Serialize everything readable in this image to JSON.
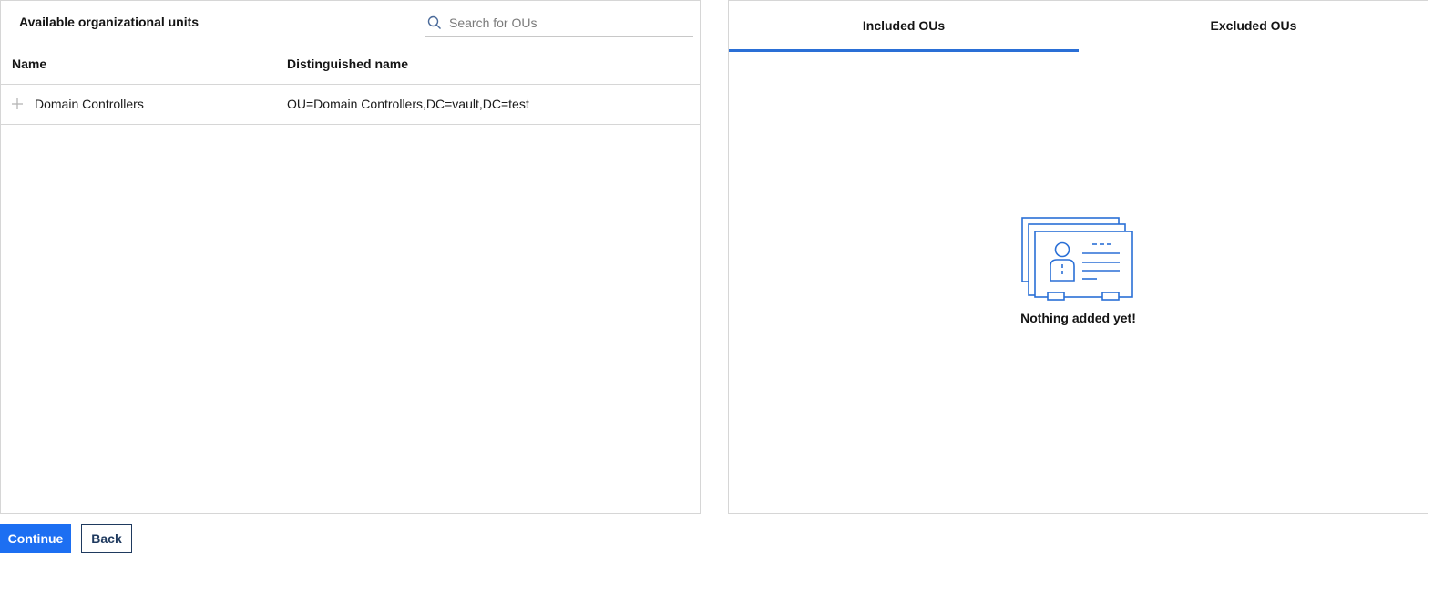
{
  "left_panel": {
    "title": "Available organizational units",
    "search": {
      "placeholder": "Search for OUs",
      "value": ""
    },
    "columns": {
      "name": "Name",
      "distinguished_name": "Distinguished name"
    },
    "rows": [
      {
        "name": "Domain Controllers",
        "distinguished_name": "OU=Domain Controllers,DC=vault,DC=test"
      }
    ]
  },
  "right_panel": {
    "tabs": [
      {
        "label": "Included OUs",
        "active": true
      },
      {
        "label": "Excluded OUs",
        "active": false
      }
    ],
    "empty_state": {
      "icon": "id-cards-icon",
      "text": "Nothing added yet!"
    }
  },
  "actions": {
    "continue_label": "Continue",
    "back_label": "Back"
  },
  "colors": {
    "accent": "#1d6ff2",
    "tab_indicator": "#2a6fd6",
    "illustration": "#2a6fd6",
    "back_border": "#1f3a5f"
  }
}
